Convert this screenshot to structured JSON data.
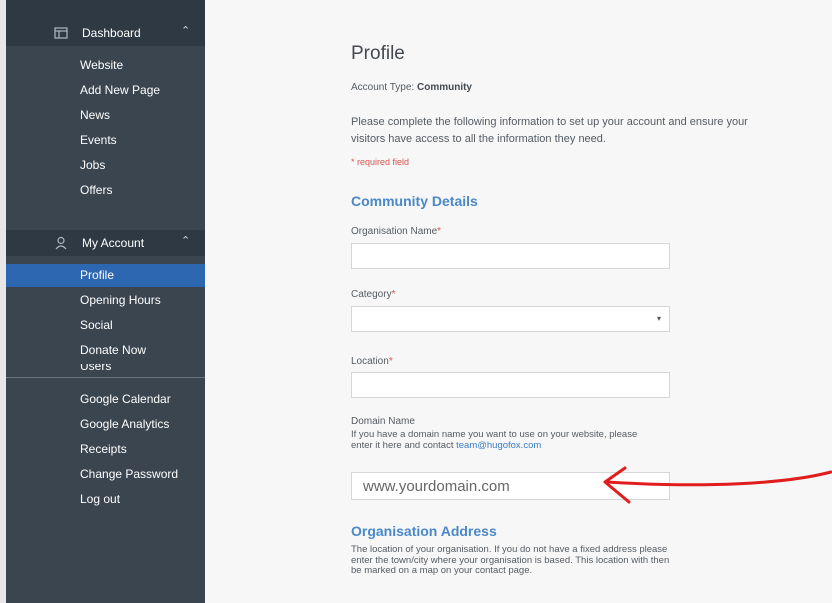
{
  "sidebar": {
    "sections": [
      {
        "title": "Dashboard",
        "icon": "dashboard-icon",
        "items": [
          {
            "label": "Website"
          },
          {
            "label": "Add New Page"
          },
          {
            "label": "News"
          },
          {
            "label": "Events"
          },
          {
            "label": "Jobs"
          },
          {
            "label": "Offers"
          }
        ]
      },
      {
        "title": "My Account",
        "icon": "user-icon",
        "items": [
          {
            "label": "Profile",
            "active": true
          },
          {
            "label": "Opening Hours"
          },
          {
            "label": "Social"
          },
          {
            "label": "Donate Now"
          },
          {
            "label": "Users"
          },
          {
            "label": "Google Calendar"
          },
          {
            "label": "Google Analytics"
          },
          {
            "label": "Receipts"
          },
          {
            "label": "Change Password"
          },
          {
            "label": "Log out"
          }
        ]
      }
    ]
  },
  "main": {
    "title": "Profile",
    "account_type_label": "Account Type:",
    "account_type_value": "Community",
    "intro": "Please complete the following information to set up your account and ensure your visitors have access to all the information they need.",
    "required_note": "* required field",
    "community_details": {
      "title": "Community Details",
      "organisation_name": {
        "label": "Organisation Name",
        "required": "*",
        "value": ""
      },
      "category": {
        "label": "Category",
        "required": "*",
        "value": ""
      },
      "location": {
        "label": "Location",
        "required": "*",
        "value": ""
      },
      "domain_name": {
        "label": "Domain Name",
        "help": "If you have a domain name you want to use on your website, please enter it here and contact",
        "email": "team@hugofox.com",
        "placeholder": "www.yourdomain.com"
      }
    },
    "organisation_address": {
      "title": "Organisation Address",
      "help": "The location of your organisation. If you do not have a fixed address please enter the town/city where your organisation is based. This location with then be marked on a map on your contact page."
    }
  },
  "colors": {
    "sidebar_bg": "#3b4550",
    "sidebar_header_bg": "#2e3944",
    "active_item": "#2d66b1",
    "section_title": "#4a88c7",
    "required": "#d9534f",
    "annotation_arrow": "#e01e1e"
  }
}
